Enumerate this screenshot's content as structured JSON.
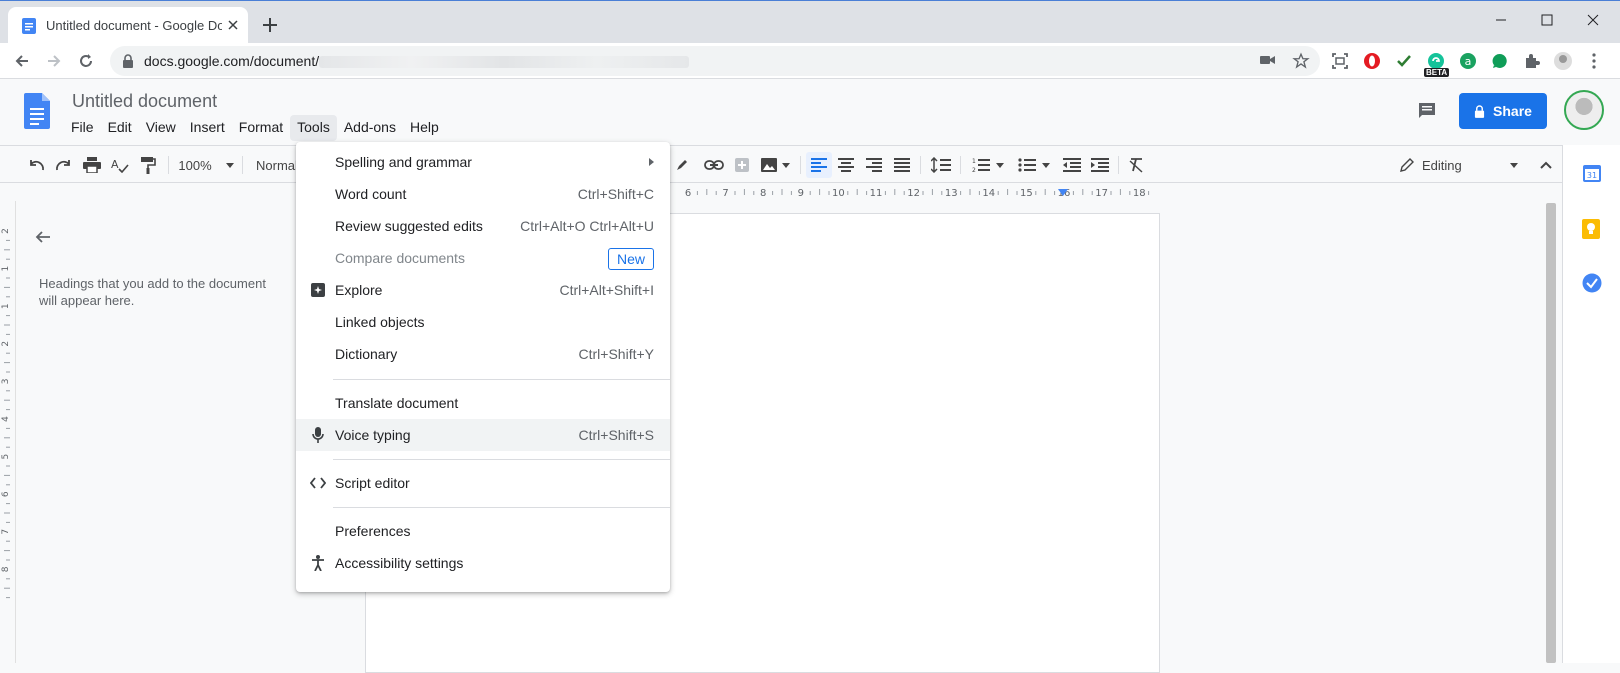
{
  "browser": {
    "tab_title": "Untitled document - Google Docs",
    "url_prefix": "docs.google.com/document/",
    "beta_badge": "BETA"
  },
  "docs": {
    "title": "Untitled document",
    "menu": [
      "File",
      "Edit",
      "View",
      "Insert",
      "Format",
      "Tools",
      "Add-ons",
      "Help"
    ],
    "share_label": "Share",
    "zoom": "100%",
    "style": "Normal",
    "mode": "Editing",
    "outline_placeholder": "Headings that you add to the document will appear here.",
    "ruler_marks": [
      "6",
      "7",
      "8",
      "9",
      "10",
      "11",
      "12",
      "13",
      "14",
      "15",
      "16",
      "17",
      "18"
    ],
    "vruler_marks": [
      "2",
      "1",
      "1",
      "2",
      "3",
      "4",
      "5",
      "6",
      "7",
      "8"
    ]
  },
  "tools_menu": {
    "items": [
      {
        "label": "Spelling and grammar",
        "shortcut": "",
        "submenu": true
      },
      {
        "label": "Word count",
        "shortcut": "Ctrl+Shift+C"
      },
      {
        "label": "Review suggested edits",
        "shortcut": "Ctrl+Alt+O Ctrl+Alt+U"
      },
      {
        "label": "Compare documents",
        "badge": "New",
        "disabled": true
      },
      {
        "label": "Explore",
        "shortcut": "Ctrl+Alt+Shift+I",
        "icon": "explore-icon"
      },
      {
        "label": "Linked objects",
        "shortcut": ""
      },
      {
        "label": "Dictionary",
        "shortcut": "Ctrl+Shift+Y"
      },
      {
        "label": "Translate document",
        "shortcut": ""
      },
      {
        "label": "Voice typing",
        "shortcut": "Ctrl+Shift+S",
        "icon": "microphone-icon",
        "highlighted": true
      },
      {
        "label": "Script editor",
        "shortcut": "",
        "icon": "code-icon"
      },
      {
        "label": "Preferences",
        "shortcut": ""
      },
      {
        "label": "Accessibility settings",
        "shortcut": "",
        "icon": "accessibility-icon"
      }
    ]
  },
  "colors": {
    "accent": "#1a73e8",
    "docs_blue": "#4285f4"
  }
}
